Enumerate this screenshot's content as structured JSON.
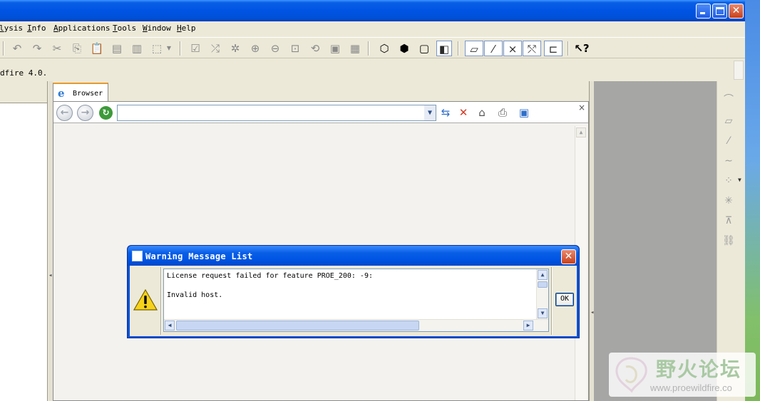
{
  "menubar": {
    "items": [
      "lysis",
      "Info",
      "Applications",
      "Tools",
      "Window",
      "Help"
    ]
  },
  "message_line": {
    "text": "dfire 4.0."
  },
  "browser": {
    "tab_label": "Browser",
    "address_value": "",
    "close_glyph": "×"
  },
  "dialog": {
    "title": "Warning Message List",
    "messages": [
      "License request failed for feature PROE_200: -9:",
      "Invalid host."
    ],
    "ok_label": "OK"
  },
  "watermark": {
    "name": "野火论坛",
    "url": "www.proewildfire.co"
  },
  "colors": {
    "titlebar_blue": "#0054e3",
    "close_red": "#c9401c",
    "window_face": "#ece9d8",
    "gray_area": "#a6a6a5"
  },
  "icons": {
    "toolbar": [
      "undo-icon",
      "redo-icon",
      "cut-icon",
      "copy-icon",
      "paste-icon",
      "paste-special-icon",
      "regenerate-icon",
      "select-box-icon",
      "refit-icon",
      "spin-center-icon",
      "orient-icon",
      "zoom-in-icon",
      "zoom-out-icon",
      "zoom-fit-icon",
      "repaint-icon",
      "view-manager-icon",
      "saved-views-icon",
      "wireframe-icon",
      "hidden-line-icon",
      "no-hidden-icon",
      "shading-icon",
      "datum-plane-display-icon",
      "datum-axis-display-icon",
      "datum-point-display-icon",
      "csys-display-icon",
      "annotation-display-icon",
      "whats-this-icon"
    ],
    "right_toolbar": [
      "sketch-tool-icon",
      "datum-plane-icon",
      "datum-axis-icon",
      "datum-curve-icon",
      "datum-point-icon",
      "csys-icon",
      "analysis-icon",
      "link-icon"
    ],
    "dialog": [
      "warning-icon"
    ]
  }
}
